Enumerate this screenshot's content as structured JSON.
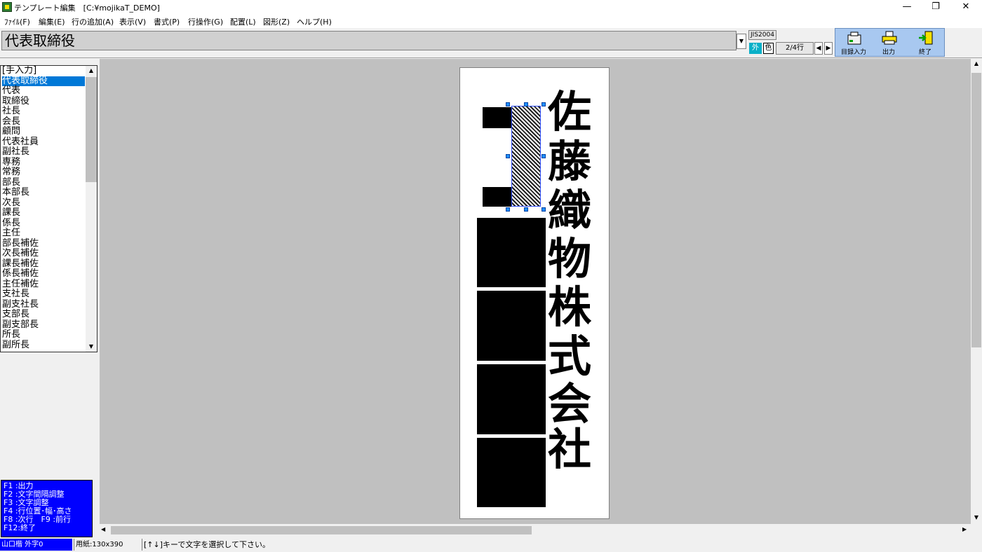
{
  "window": {
    "title": "テンプレート編集　[C:¥mojikaT_DEMO]",
    "minimize_label": "—",
    "restore_label": "❐",
    "close_label": "✕"
  },
  "menu": [
    "ﾌｧｲﾙ(F)",
    "編集(E)",
    "行の追加(A)",
    "表示(V)",
    "書式(P)",
    "行操作(G)",
    "配置(L)",
    "図形(Z)",
    "ヘルプ(H)"
  ],
  "toolbar": {
    "current_text": "代表取締役",
    "jis_label": "JIS2004",
    "gaiji_label": "外",
    "color_label": "色",
    "line_counter": "2/4行",
    "prev_label": "◀",
    "next_label": "▶",
    "buttons": {
      "register_input": "目録入力",
      "output": "出力",
      "exit": "終了"
    }
  },
  "list": {
    "selected_index": 1,
    "items": [
      "[手入力]",
      "代表取締役",
      "代表",
      "取締役",
      "社長",
      "会長",
      "顧問",
      "代表社員",
      "副社長",
      "専務",
      "常務",
      "部長",
      "本部長",
      "次長",
      "課長",
      "係長",
      "主任",
      "部長補佐",
      "次長補佐",
      "課長補佐",
      "係長補佐",
      "主任補佐",
      "支社長",
      "副支社長",
      "支部長",
      "副支部長",
      "所長",
      "副所長"
    ],
    "scroll_up": "▲",
    "scroll_down": "▼"
  },
  "help": [
    "F1 :出力",
    "F2 :文字間隔調整",
    "F3 :文字調整",
    "F4 :行位置･幅･高さ",
    "F8 :次行　F9 :前行",
    "F12:終了"
  ],
  "document": {
    "company_chars": [
      "佐",
      "藤",
      "織",
      "物",
      "株",
      "式",
      "会",
      "社"
    ]
  },
  "status": {
    "font": "山口楷 外字0",
    "paper": "用紙:130x390",
    "message": "[↑↓]キーで文字を選択して下さい。"
  },
  "colors": {
    "selection": "#0078d7",
    "help_bg": "#0000ff",
    "toolbar_accent": "#a8c8f0",
    "gaiji": "#0ab0c8"
  }
}
